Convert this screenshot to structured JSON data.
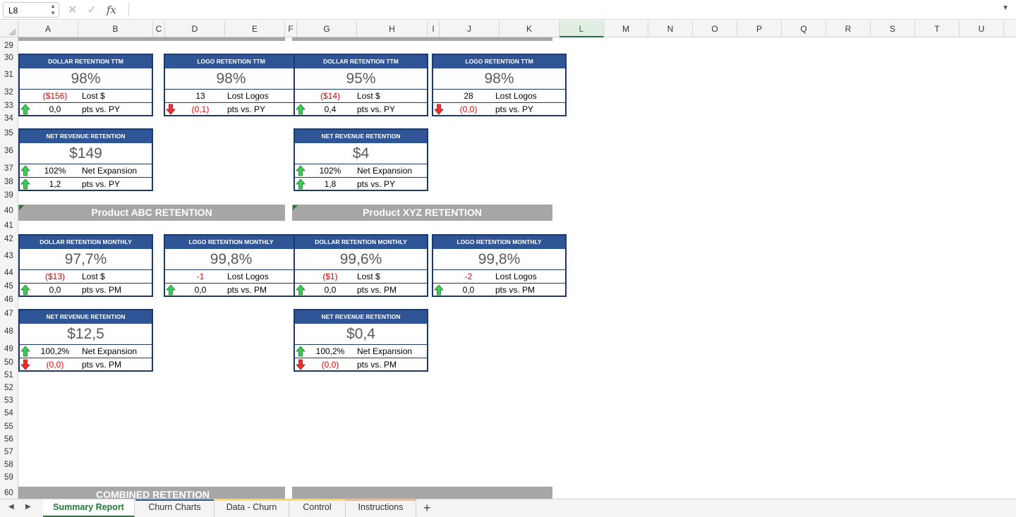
{
  "formula_bar": {
    "cell_ref": "L8",
    "fx": "fx",
    "value": ""
  },
  "columns": [
    "A",
    "B",
    "C",
    "D",
    "E",
    "F",
    "G",
    "H",
    "I",
    "J",
    "K",
    "L",
    "M",
    "N",
    "O",
    "P",
    "Q",
    "R",
    "S",
    "T",
    "U"
  ],
  "selected_column": "L",
  "rows": [
    "29",
    "30",
    "31",
    "32",
    "33",
    "34",
    "35",
    "36",
    "37",
    "38",
    "39",
    "40",
    "41",
    "42",
    "43",
    "44",
    "45",
    "46",
    "47",
    "48",
    "49",
    "50",
    "51",
    "52",
    "53",
    "54",
    "55",
    "56",
    "57",
    "58",
    "59",
    "60"
  ],
  "cards": [
    {
      "title": "DOLLAR RETENTION TTM",
      "value": "98%",
      "row1": {
        "num": "($156)",
        "label": "Lost $",
        "num_red": true
      },
      "row2": {
        "icon": "up",
        "num": "0,0",
        "label": "pts vs. PY",
        "num_red": false
      }
    },
    {
      "title": "LOGO RETENTION TTM",
      "value": "98%",
      "row1": {
        "num": "13",
        "label": "Lost Logos",
        "num_red": false
      },
      "row2": {
        "icon": "down",
        "num": "(0,1)",
        "label": "pts vs. PY",
        "num_red": true
      }
    },
    {
      "title": "DOLLAR RETENTION TTM",
      "value": "95%",
      "row1": {
        "num": "($14)",
        "label": "Lost $",
        "num_red": true
      },
      "row2": {
        "icon": "up",
        "num": "0,4",
        "label": "pts vs. PY",
        "num_red": false
      }
    },
    {
      "title": "LOGO RETENTION TTM",
      "value": "98%",
      "row1": {
        "num": "28",
        "label": "Lost Logos",
        "num_red": false
      },
      "row2": {
        "icon": "down",
        "num": "(0,0)",
        "label": "pts vs. PY",
        "num_red": true
      }
    },
    {
      "title": "NET REVENUE RETENTION",
      "value": "$149",
      "row1": {
        "icon": "up",
        "num": "102%",
        "label": "Net Expansion",
        "num_red": false
      },
      "row2": {
        "icon": "up",
        "num": "1,2",
        "label": "pts vs. PY",
        "num_red": false
      }
    },
    {
      "title": "NET REVENUE RETENTION",
      "value": "$4",
      "row1": {
        "icon": "up",
        "num": "102%",
        "label": "Net Expansion",
        "num_red": false
      },
      "row2": {
        "icon": "up",
        "num": "1,8",
        "label": "pts vs. PY",
        "num_red": false
      }
    },
    {
      "title": "DOLLAR RETENTION MONTHLY",
      "value": "97,7%",
      "row1": {
        "num": "($13)",
        "label": "Lost $",
        "num_red": true
      },
      "row2": {
        "icon": "up",
        "num": "0,0",
        "label": "pts vs. PM",
        "num_red": false
      }
    },
    {
      "title": "LOGO RETENTION MONTHLY",
      "value": "99,8%",
      "row1": {
        "num": "-1",
        "label": "Lost Logos",
        "num_red": true
      },
      "row2": {
        "icon": "up",
        "num": "0,0",
        "label": "pts vs. PM",
        "num_red": false
      }
    },
    {
      "title": "DOLLAR RETENTION MONTHLY",
      "value": "99,6%",
      "row1": {
        "num": "($1)",
        "label": "Lost $",
        "num_red": true
      },
      "row2": {
        "icon": "up",
        "num": "0,0",
        "label": "pts vs. PM",
        "num_red": false
      }
    },
    {
      "title": "LOGO RETENTION MONTHLY",
      "value": "99,8%",
      "row1": {
        "num": "-2",
        "label": "Lost Logos",
        "num_red": true
      },
      "row2": {
        "icon": "up",
        "num": "0,0",
        "label": "pts vs. PM",
        "num_red": false
      }
    },
    {
      "title": "NET REVENUE RETENTION",
      "value": "$12,5",
      "row1": {
        "icon": "up",
        "num": "100,2%",
        "label": "Net Expansion",
        "num_red": false
      },
      "row2": {
        "icon": "down",
        "num": "(0,0)",
        "label": "pts vs. PM",
        "num_red": true
      }
    },
    {
      "title": "NET REVENUE RETENTION",
      "value": "$0,4",
      "row1": {
        "icon": "up",
        "num": "100,2%",
        "label": "Net Expansion",
        "num_red": false
      },
      "row2": {
        "icon": "down",
        "num": "(0,0)",
        "label": "pts vs. PM",
        "num_red": true
      }
    }
  ],
  "bands": {
    "abc": "Product ABC RETENTION",
    "xyz": "Product XYZ RETENTION",
    "combined": "COMBINED RETENTION"
  },
  "tabs": [
    {
      "label": "Summary Report",
      "active": true,
      "color": "#1e7b34"
    },
    {
      "label": "Churn Charts",
      "active": false,
      "color": "#2f5597"
    },
    {
      "label": "Data - Churn",
      "active": false,
      "color": "#ffd966"
    },
    {
      "label": "Control",
      "active": false,
      "color": "#ffd966"
    },
    {
      "label": "Instructions",
      "active": false,
      "color": "#f4b183"
    }
  ],
  "add_sheet_label": "+",
  "colors": {
    "card_header": "#2f5597",
    "card_border": "#1f3864",
    "band": "#a6a6a6",
    "arrow_up": "#2ecc40",
    "arrow_down": "#e02020",
    "negative": "#e00000"
  }
}
